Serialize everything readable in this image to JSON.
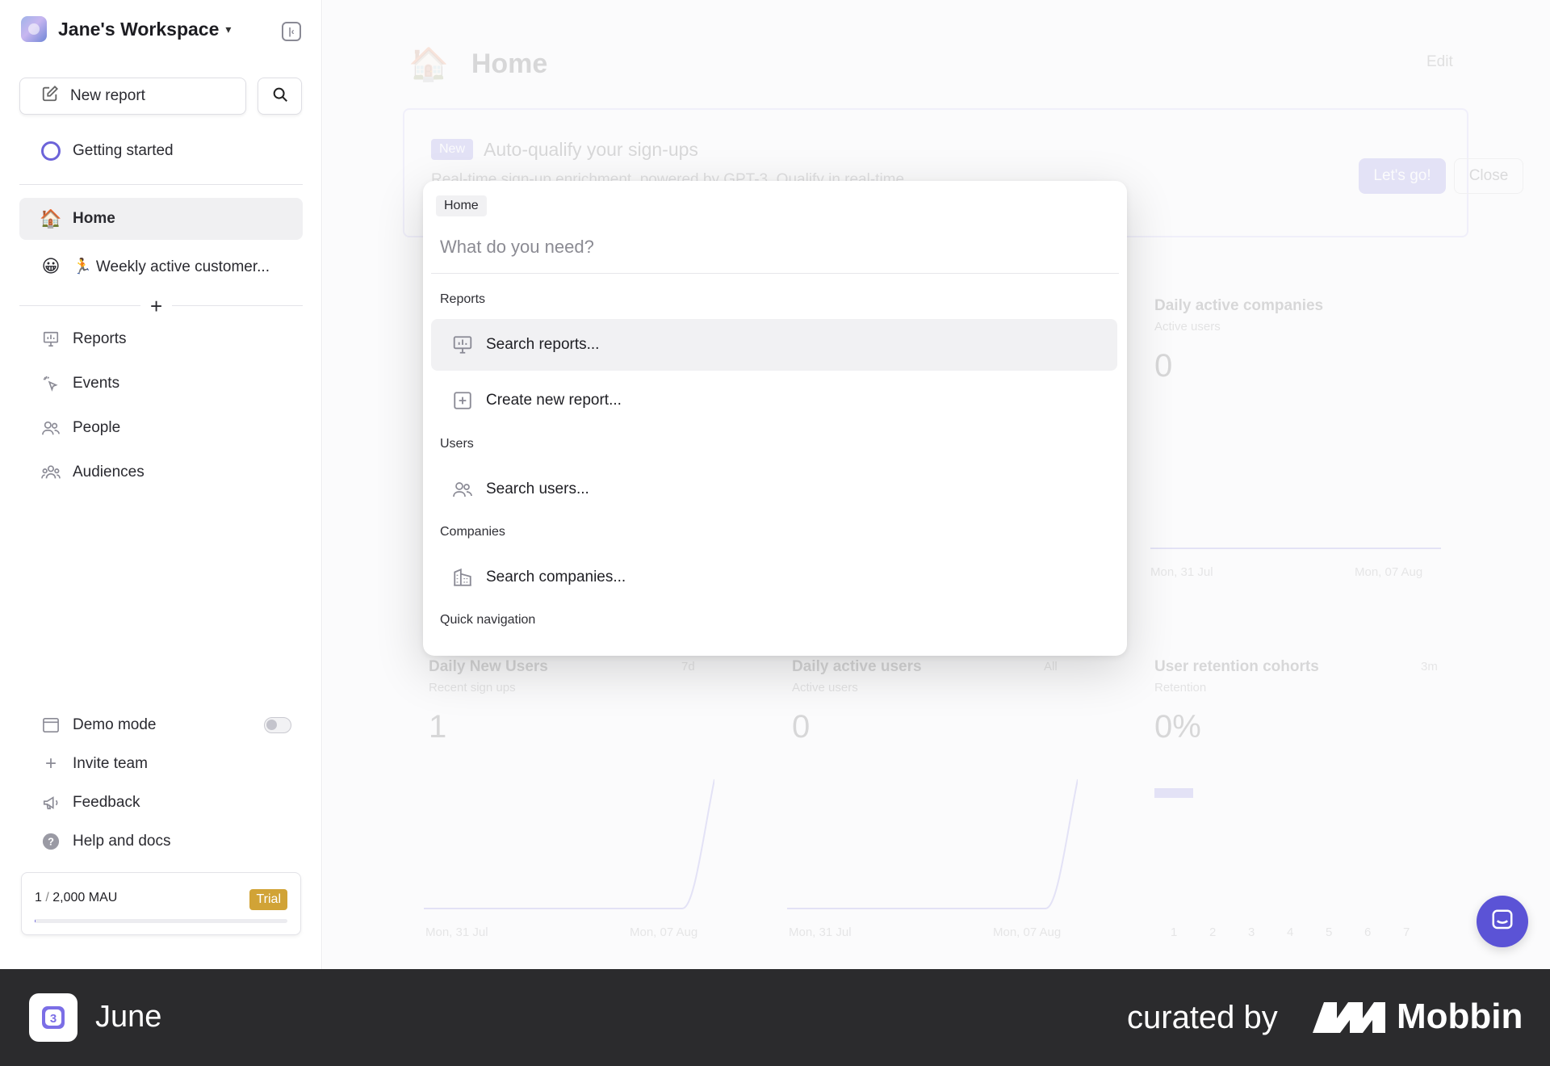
{
  "sidebar": {
    "workspace_name": "Jane's Workspace",
    "new_report_label": "New report",
    "getting_started_label": "Getting started",
    "pinned": [
      {
        "label": "Home",
        "icon": "house-emoji"
      },
      {
        "label": "🏃 Weekly active customer...",
        "icon": "grinning-face-emoji"
      }
    ],
    "add_symbol": "+",
    "nav": [
      {
        "label": "Reports",
        "icon": "presentation-chart-icon"
      },
      {
        "label": "Events",
        "icon": "cursor-click-icon"
      },
      {
        "label": "People",
        "icon": "users-icon"
      },
      {
        "label": "Audiences",
        "icon": "user-group-icon"
      }
    ],
    "bottom": {
      "demo_mode_label": "Demo mode",
      "invite_label": "Invite team",
      "feedback_label": "Feedback",
      "help_label": "Help and docs"
    },
    "mau": {
      "used": "1",
      "limit": "2,000 MAU",
      "separator": " / ",
      "plan_badge": "Trial",
      "progress_fraction": 0.0005
    }
  },
  "dashboard": {
    "title": "Home",
    "edit_label": "Edit",
    "banner": {
      "badge": "New",
      "title": "Auto-qualify your sign-ups",
      "subtitle": "Real-time sign-up enrichment, powered by GPT-3. Qualify in real-time.",
      "primary_label": "Let's go!",
      "close_label": "Close"
    },
    "cards": [
      {
        "title": "Daily active companies",
        "sub": "Active users",
        "value": "0",
        "x_start": "Mon, 31 Jul",
        "x_end": "Mon, 07 Aug"
      },
      {
        "title": "Daily New Users",
        "sub": "Recent sign ups",
        "value": "1",
        "x_start": "Mon, 31 Jul",
        "x_end": "Mon, 07 Aug",
        "range": "7d"
      },
      {
        "title": "Daily active users",
        "sub": "Active users",
        "value": "0",
        "x_start": "Mon, 31 Jul",
        "x_end": "Mon, 07 Aug",
        "range": "All"
      },
      {
        "title": "User retention cohorts",
        "sub": "Retention",
        "value": "0%",
        "range": "3m",
        "ticks": [
          "1",
          "2",
          "3",
          "4",
          "5",
          "6",
          "7"
        ]
      }
    ]
  },
  "command_menu": {
    "breadcrumb": "Home",
    "placeholder": "What do you need?",
    "sections": {
      "reports": "Reports",
      "users": "Users",
      "companies": "Companies",
      "quick_nav": "Quick navigation"
    },
    "options": {
      "search_reports": "Search reports...",
      "create_report": "Create new report...",
      "search_users": "Search users...",
      "search_companies": "Search companies..."
    }
  },
  "footer": {
    "app_name": "June",
    "curated_by": "curated by",
    "brand": "Mobbin"
  },
  "colors": {
    "accent": "#6c63d9",
    "trial_badge": "#d1a336",
    "footer_bg": "#2b2b2d"
  }
}
